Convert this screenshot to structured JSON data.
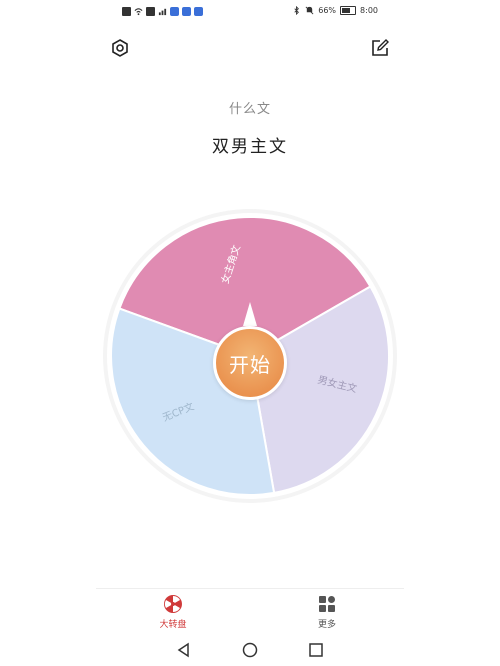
{
  "status_bar": {
    "battery": "66%",
    "time": "8:00"
  },
  "header": {
    "subtitle": "什么文",
    "title": "双男主文"
  },
  "wheel": {
    "start_label": "开始",
    "segments": [
      {
        "label": "女主角文",
        "color": "#e08bb2"
      },
      {
        "label": "男女主文",
        "color": "#ddd9ef"
      },
      {
        "label": "无CP文",
        "color": "#cfe3f7"
      }
    ]
  },
  "bottom_nav": {
    "items": [
      {
        "label": "大转盘",
        "icon": "wheel-icon",
        "active": true
      },
      {
        "label": "更多",
        "icon": "grid-icon",
        "active": false
      }
    ]
  },
  "colors": {
    "accent": "#d03a3a",
    "start_button": "#ea9350"
  }
}
